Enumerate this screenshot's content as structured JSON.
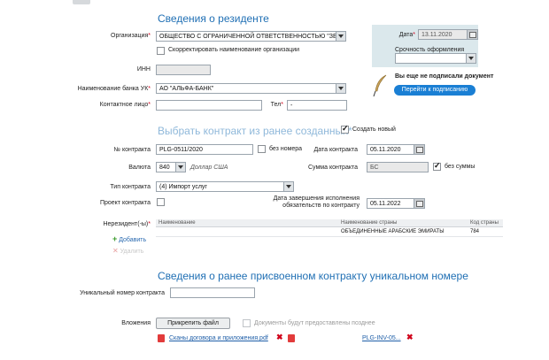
{
  "resident": {
    "title": "Сведения о резиденте",
    "org_label": "Организация",
    "org_value": "ОБЩЕСТВО С ОГРАНИЧЕННОЙ ОТВЕТСТВЕННОСТЬЮ \"ЗЕ",
    "correct_name_label": "Скорректировать наименование организации",
    "inn_label": "ИНН",
    "inn_value": "",
    "bank_label": "Наименование банка УК",
    "bank_value": "АО \"АЛЬФА-БАНК\"",
    "contact_label": "Контактное лицо",
    "contact_value": "",
    "tel_label": "Тел",
    "tel_value": "-"
  },
  "side_panel": {
    "date_label": "Дата",
    "date_value": "13.11.2020",
    "urgency_label": "Срочность оформления",
    "urgency_value": "",
    "not_signed_text": "Вы еще не подписали документ",
    "sign_button": "Перейти к подписанию"
  },
  "contract": {
    "title": "Выбрать контракт из ранее созданных",
    "create_new_label": "Создать новый",
    "number_label": "№ контракта",
    "number_value": "PLG-0511/2020",
    "no_number_label": "без номера",
    "date_label": "Дата контракта",
    "date_value": "05.11.2020",
    "currency_label": "Валюта",
    "currency_code": "840",
    "currency_name": "Доллар США",
    "sum_label": "Сумма контракта",
    "sum_value": "БС",
    "no_sum_label": "без суммы",
    "type_label": "Тип контракта",
    "type_value": "(4) Импорт услуг",
    "project_label": "Проект контракта",
    "end_date_label_1": "Дата завершения исполнения",
    "end_date_label_2": "обязательств по контракту",
    "end_date_value": "05.11.2022"
  },
  "nonresident": {
    "label": "Нерезидент(-ы)",
    "add_label": "Добавить",
    "delete_label": "Удалить",
    "columns": [
      "Наименование",
      "Наименование страны",
      "Код страны"
    ],
    "rows": [
      {
        "name": "",
        "country": "ОБЪЕДИНЕННЫЕ АРАБСКИЕ ЭМИРАТЫ",
        "code": "784"
      }
    ]
  },
  "unique": {
    "title": "Сведения о ранее присвоенном контракту уникальном номере",
    "number_label": "Уникальный номер контракта",
    "number_value": ""
  },
  "attachments": {
    "label": "Вложения",
    "attach_button": "Прикрепить файл",
    "later_label": "Документы будут предоставлены позднее",
    "files": [
      "Сканы договора и приложения.pdf",
      "PLG-INV-05..."
    ]
  }
}
